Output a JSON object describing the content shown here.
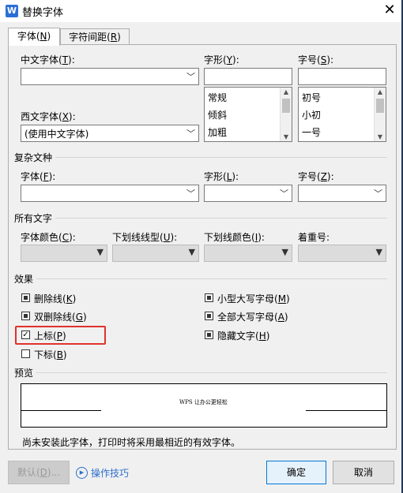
{
  "window": {
    "title": "替换字体",
    "app_icon_letter": "W"
  },
  "tabs": [
    {
      "label": "字体(",
      "key": "N",
      "suffix": ")"
    },
    {
      "label": "字符间距(",
      "key": "R",
      "suffix": ")"
    }
  ],
  "chinese_font": {
    "label": "中文字体(",
    "key": "T",
    "suffix": "):",
    "value": ""
  },
  "font_style": {
    "label": "字形(",
    "key": "Y",
    "suffix": "):",
    "value": "",
    "options": [
      "常规",
      "倾斜",
      "加粗"
    ]
  },
  "font_size": {
    "label": "字号(",
    "key": "S",
    "suffix": "):",
    "value": "",
    "options": [
      "初号",
      "小初",
      "一号"
    ]
  },
  "western_font": {
    "label": "西文字体(",
    "key": "X",
    "suffix": "):",
    "value": "(使用中文字体)"
  },
  "complex": {
    "section": "复杂文种",
    "font": {
      "label": "字体(",
      "key": "F",
      "suffix": "):",
      "value": ""
    },
    "style": {
      "label": "字形(",
      "key": "L",
      "suffix": "):",
      "value": ""
    },
    "size": {
      "label": "字号(",
      "key": "Z",
      "suffix": "):",
      "value": ""
    }
  },
  "all_text": {
    "section": "所有文字",
    "color": {
      "label": "字体颜色(",
      "key": "C",
      "suffix": "):"
    },
    "underline_type": {
      "label": "下划线线型(",
      "key": "U",
      "suffix": "):"
    },
    "underline_color": {
      "label": "下划线颜色(",
      "key": "I",
      "suffix": "):"
    },
    "emphasis": {
      "label": "着重号:"
    }
  },
  "effects": {
    "section": "效果",
    "strikethrough": {
      "label": "删除线(",
      "key": "K",
      "suffix": ")",
      "state": "indeterminate"
    },
    "double_strikethrough": {
      "label": "双删除线(",
      "key": "G",
      "suffix": ")",
      "state": "indeterminate"
    },
    "superscript": {
      "label": "上标(",
      "key": "P",
      "suffix": ")",
      "state": "checked",
      "check_glyph": "✓"
    },
    "subscript": {
      "label": "下标(",
      "key": "B",
      "suffix": ")",
      "state": "unchecked"
    },
    "small_caps": {
      "label": "小型大写字母(",
      "key": "M",
      "suffix": ")",
      "state": "indeterminate"
    },
    "all_caps": {
      "label": "全部大写字母(",
      "key": "A",
      "suffix": ")",
      "state": "indeterminate"
    },
    "hidden": {
      "label": "隐藏文字(",
      "key": "H",
      "suffix": ")",
      "state": "indeterminate"
    }
  },
  "preview": {
    "section": "预览",
    "sample": "WPS 让办公更轻松"
  },
  "note": "尚未安装此字体，打印时将采用最相近的有效字体。",
  "buttons": {
    "default": {
      "label": "默认(",
      "key": "D",
      "suffix": ")..."
    },
    "tips": "操作技巧",
    "ok": "确定",
    "cancel": "取消"
  },
  "colors": {
    "highlight": "#e0322b",
    "link": "#2e6fcf",
    "app_icon": "#2b6fd6"
  }
}
